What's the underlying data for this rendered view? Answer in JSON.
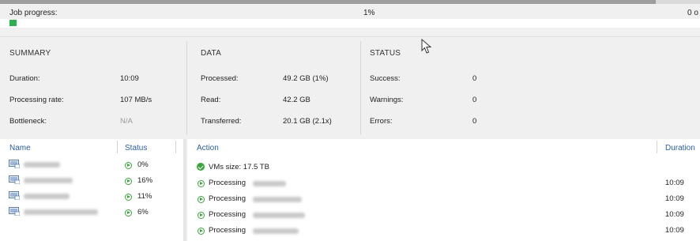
{
  "job": {
    "progress_label": "Job progress:",
    "progress_percent": "1%",
    "progress_right": "0 o",
    "progress_fraction": 0.01
  },
  "summary": {
    "title": "SUMMARY",
    "rows": [
      {
        "label": "Duration:",
        "value": "10:09"
      },
      {
        "label": "Processing rate:",
        "value": "107 MB/s"
      },
      {
        "label": "Bottleneck:",
        "value": "N/A"
      }
    ]
  },
  "data": {
    "title": "DATA",
    "rows": [
      {
        "label": "Processed:",
        "value": "49.2 GB (1%)"
      },
      {
        "label": "Read:",
        "value": "42.2 GB"
      },
      {
        "label": "Transferred:",
        "value": "20.1 GB (2.1x)"
      }
    ]
  },
  "status": {
    "title": "STATUS",
    "rows": [
      {
        "label": "Success:",
        "value": "0"
      },
      {
        "label": "Warnings:",
        "value": "0"
      },
      {
        "label": "Errors:",
        "value": "0"
      }
    ]
  },
  "vm_list": {
    "headers": {
      "name": "Name",
      "status": "Status"
    },
    "rows": [
      {
        "status": "0%"
      },
      {
        "status": "16%"
      },
      {
        "status": "11%"
      },
      {
        "status": "6%"
      }
    ]
  },
  "actions": {
    "headers": {
      "action": "Action",
      "duration": "Duration"
    },
    "rows": [
      {
        "text": "VMs size: 17.5 TB",
        "duration": ""
      },
      {
        "text": "Processing",
        "duration": "10:09"
      },
      {
        "text": "Processing",
        "duration": "10:09"
      },
      {
        "text": "Processing",
        "duration": "10:09"
      },
      {
        "text": "Processing",
        "duration": "10:09"
      }
    ]
  },
  "colors": {
    "accent_green": "#2bb24c",
    "header_blue": "#2b5fa3"
  },
  "icons": {
    "vm": "vm-icon",
    "running": "play-circle-icon",
    "ok": "check-circle-icon",
    "cursor": "mouse-cursor-icon"
  }
}
